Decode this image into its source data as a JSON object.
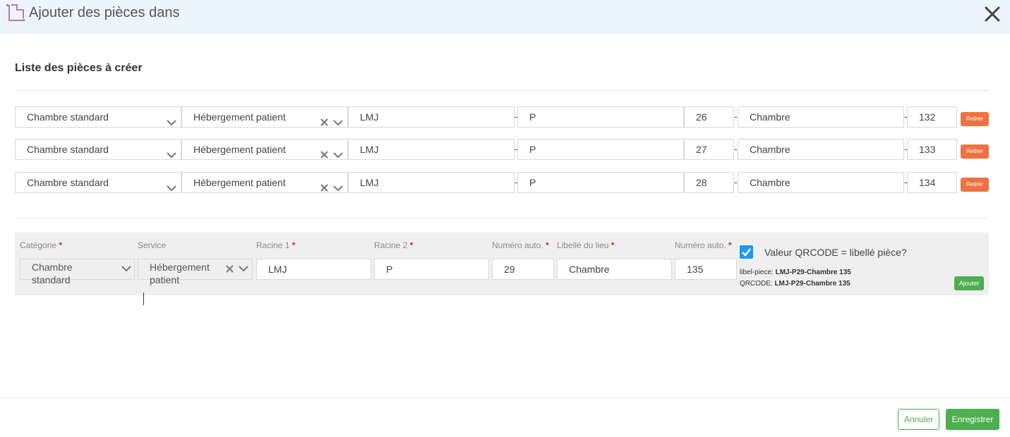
{
  "dialog": {
    "title": "Ajouter des pièces dans",
    "section_title": "Liste des pièces à créer"
  },
  "rows": [
    {
      "categorie": "Chambre standard",
      "service": "Hébergement patient",
      "racine1": "LMJ",
      "racine2": "P",
      "numero": "26",
      "libelle": "Chambre",
      "numero2": "132",
      "retirer": "Retirer"
    },
    {
      "categorie": "Chambre standard",
      "service": "Hébergement patient",
      "racine1": "LMJ",
      "racine2": "P",
      "numero": "27",
      "libelle": "Chambre",
      "numero2": "133",
      "retirer": "Retirer"
    },
    {
      "categorie": "Chambre standard",
      "service": "Hébergement patient",
      "racine1": "LMJ",
      "racine2": "P",
      "numero": "28",
      "libelle": "Chambre",
      "numero2": "134",
      "retirer": "Retirer"
    }
  ],
  "separator": "-",
  "form": {
    "labels": {
      "categorie": "Catégorie",
      "service": "Service",
      "racine1": "Racine 1",
      "racine2": "Racine 2",
      "numero_auto": "Numéro auto.",
      "libelle_lieu": "Libellé du lieu",
      "numero_auto2": "Numéro auto.",
      "required_mark": "*"
    },
    "values": {
      "categorie_line1": "Chambre",
      "categorie_line2": "standard",
      "service_line1": "Hébergement",
      "service_line2": "patient",
      "racine1": "LMJ",
      "racine2": "P",
      "numero_auto": "29",
      "libelle_lieu": "Chambre",
      "numero_auto2": "135"
    },
    "qrcode_checkbox_label": "Valeur QRCODE = libellé pièce?",
    "qrcode_checked": true,
    "libel_piece_label": "libel-piece:",
    "libel_piece_value": "LMJ-P29-Chambre 135",
    "qrcode_label": "QRCODE:",
    "qrcode_value": "LMJ-P29-Chambre 135",
    "ajouter": "Ajouter"
  },
  "footer": {
    "cancel": "Annuler",
    "save": "Enregistrer"
  },
  "colors": {
    "header_bg": "#ebf5fb",
    "retirer": "#ee7240",
    "primary_green": "#4caf50",
    "checkbox_blue": "#2196f3",
    "required_red": "#e02020",
    "icon_purple": "#b57ab5"
  },
  "icons": {
    "header": "rooms-icon",
    "close": "close-icon",
    "dropdown": "chevron-down-icon",
    "clear": "clear-x-icon",
    "check": "checkmark-icon"
  }
}
